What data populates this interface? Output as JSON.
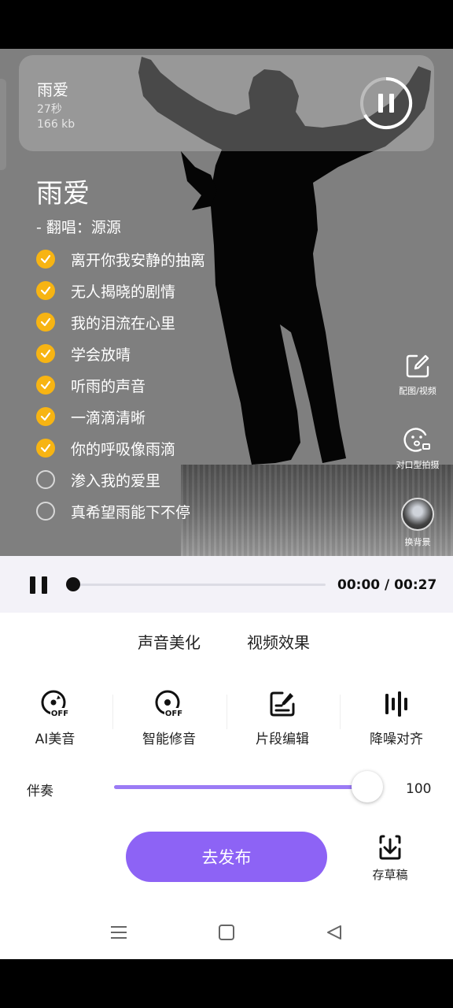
{
  "song_card": {
    "title": "雨爱",
    "duration": "27秒",
    "size": "166 kb"
  },
  "lyrics": {
    "title": "雨爱",
    "singer": "-  翻唱：源源",
    "lines": [
      {
        "text": "离开你我安静的抽离",
        "checked": true
      },
      {
        "text": "无人揭晓的剧情",
        "checked": true
      },
      {
        "text": "我的泪流在心里",
        "checked": true
      },
      {
        "text": "学会放晴",
        "checked": true
      },
      {
        "text": "听雨的声音",
        "checked": true
      },
      {
        "text": "一滴滴清晰",
        "checked": true
      },
      {
        "text": "你的呼吸像雨滴",
        "checked": true
      },
      {
        "text": "渗入我的爱里",
        "checked": false
      },
      {
        "text": "真希望雨能下不停",
        "checked": false
      }
    ]
  },
  "side_tools": [
    {
      "label": "配图/视频",
      "icon": "edit-icon"
    },
    {
      "label": "对口型拍摄",
      "icon": "lip-sync-icon"
    },
    {
      "label": "换背景",
      "icon": "avatar"
    }
  ],
  "player": {
    "current": "00:00",
    "total": "00:27",
    "time_text": "00:00 / 00:27",
    "progress": 0
  },
  "tabs": [
    {
      "label": "声音美化",
      "active": true
    },
    {
      "label": "视频效果",
      "active": false
    }
  ],
  "tools": [
    {
      "label": "AI美音",
      "icon": "ai-voice-off-icon"
    },
    {
      "label": "智能修音",
      "icon": "auto-tune-off-icon"
    },
    {
      "label": "片段编辑",
      "icon": "clip-edit-icon"
    },
    {
      "label": "降噪对齐",
      "icon": "denoise-icon"
    }
  ],
  "accompaniment": {
    "label": "伴奏",
    "value": "100",
    "level": 1.0
  },
  "publish_label": "去发布",
  "draft_label": "存草稿",
  "colors": {
    "accent": "#8d63f5",
    "check": "#f7b413",
    "tab_underline": "#f6e25a"
  }
}
